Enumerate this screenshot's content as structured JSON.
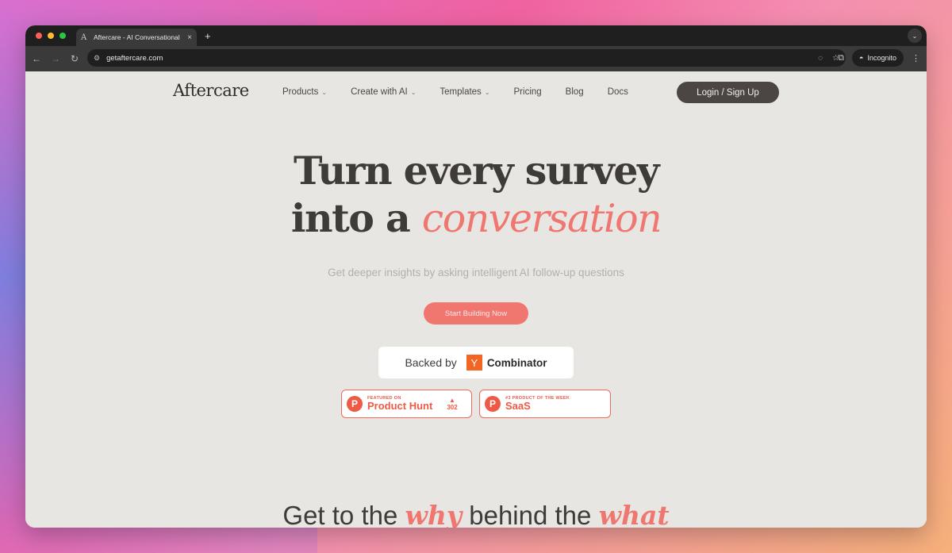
{
  "browser": {
    "tab_title": "Aftercare - AI Conversational",
    "tab_favicon": "A",
    "tab_close": "×",
    "new_tab": "+",
    "url": "getaftercare.com",
    "incognito_label": "Incognito"
  },
  "nav": {
    "logo": "Aftercare",
    "links": [
      {
        "label": "Products",
        "dropdown": true
      },
      {
        "label": "Create with AI",
        "dropdown": true
      },
      {
        "label": "Templates",
        "dropdown": true
      },
      {
        "label": "Pricing",
        "dropdown": false
      },
      {
        "label": "Blog",
        "dropdown": false
      },
      {
        "label": "Docs",
        "dropdown": false
      }
    ],
    "login_label": "Login / Sign Up"
  },
  "hero": {
    "title_line1": "Turn every survey",
    "title_line2_prefix": "into a ",
    "title_line2_accent": "conversation",
    "subtitle": "Get deeper insights by asking intelligent AI follow-up questions",
    "cta_label": "Start Building Now"
  },
  "backed": {
    "prefix": "Backed by",
    "logo_letter": "Y",
    "name": "Combinator"
  },
  "badges": [
    {
      "small": "FEATURED ON",
      "big": "Product Hunt",
      "votes": "302",
      "arrow": "▲"
    },
    {
      "small": "#3 PRODUCT OF THE WEEK",
      "big": "SaaS"
    }
  ],
  "section": {
    "part1": "Get to the ",
    "em1": "why",
    "part2": " behind the ",
    "em2": "what"
  },
  "colors": {
    "accent": "#f07670",
    "dark": "#4b4644",
    "page_bg": "#e8e6e3"
  }
}
